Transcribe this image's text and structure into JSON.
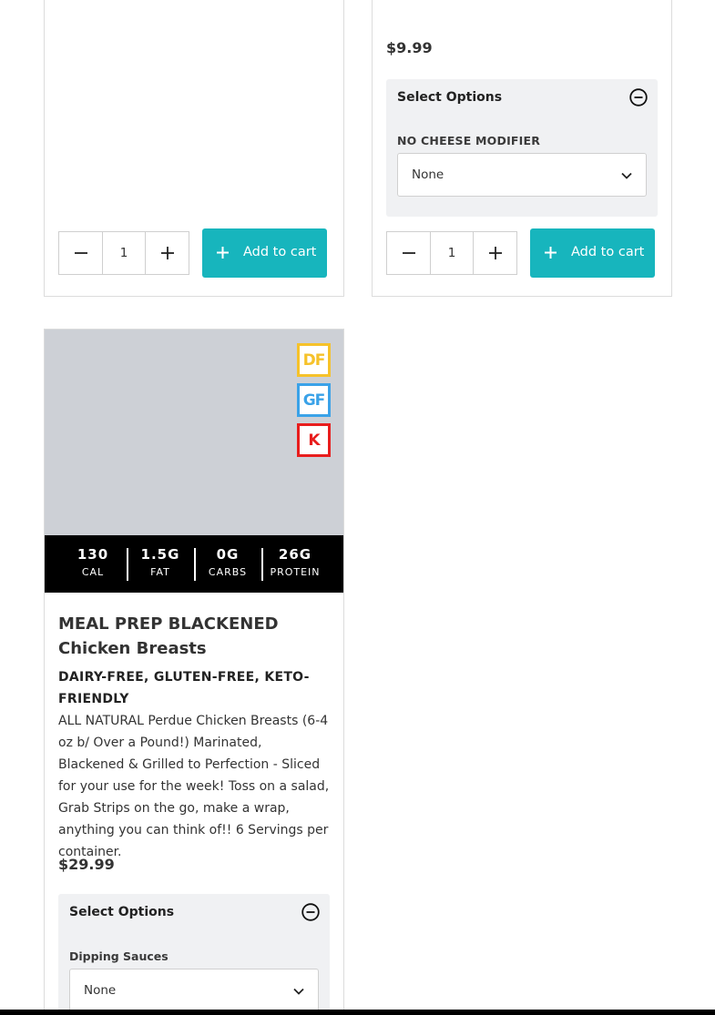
{
  "cards": {
    "top_left": {
      "quantity": "1",
      "add_to_cart": "Add to cart"
    },
    "top_right": {
      "price": "$9.99",
      "options_title": "Select Options",
      "modifier_label": "NO CHEESE MODIFIER",
      "modifier_value": "None",
      "quantity": "1",
      "add_to_cart": "Add to cart"
    },
    "bottom_left": {
      "badges": [
        "DF",
        "GF",
        "K"
      ],
      "nutrition": [
        {
          "value": "130",
          "label": "CAL"
        },
        {
          "value": "1.5G",
          "label": "FAT"
        },
        {
          "value": "0G",
          "label": "CARBS"
        },
        {
          "value": "26G",
          "label": "PROTEIN"
        }
      ],
      "title": "MEAL PREP BLACKENED Chicken Breasts",
      "tags": "DAIRY-FREE, GLUTEN-FREE, KETO-FRIENDLY",
      "description": "ALL NATURAL Perdue Chicken Breasts (6-4 oz b/ Over a Pound!) Marinated, Blackened & Grilled to Perfection - Sliced for your use for the week! Toss on a salad, Grab Strips on the go, make a wrap, anything you can think of!! 6 Servings per container.",
      "price": "$29.99",
      "options_title": "Select Options",
      "modifier_label": "Dipping Sauces",
      "modifier_value": "None"
    }
  },
  "icons": {
    "collapse": "minus-circle-icon",
    "dropdown": "chevron-down-icon",
    "decrement": "minus-icon",
    "increment": "plus-icon"
  },
  "colors": {
    "accent": "#17b5bd",
    "df_badge": "#f6c22a",
    "gf_badge": "#3aa2e8",
    "kosher_badge": "#e81d1d"
  }
}
